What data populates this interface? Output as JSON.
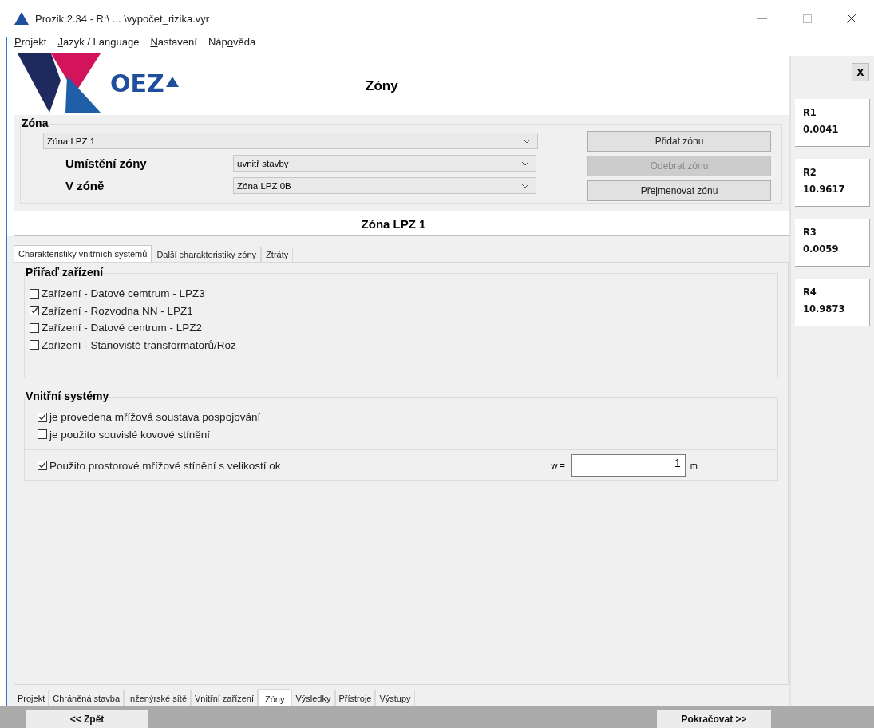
{
  "window": {
    "title": "Prozik 2.34 - R:\\ ... \\vypočet_rizika.vyr"
  },
  "menu": [
    {
      "key": "P",
      "post": "rojekt"
    },
    {
      "key": "J",
      "post": "azyk / Language"
    },
    {
      "key": "N",
      "post": "astavení"
    },
    {
      "pre": "Náp",
      "key": "o",
      "post": "věda"
    }
  ],
  "header": {
    "logo_text": "OEZ",
    "title": "Zóny"
  },
  "zone_group": {
    "legend": "Zóna",
    "zone_select": "Zóna LPZ 1",
    "fields": [
      {
        "label": "Umístění zóny",
        "value": "uvnitř stavby"
      },
      {
        "label": "V zóně",
        "value": "Zóna LPZ 0B"
      }
    ],
    "buttons": [
      {
        "label": "Přidat zónu",
        "disabled": false
      },
      {
        "label": "Odebrat zónu",
        "disabled": true
      },
      {
        "label": "Přejmenovat zónu",
        "disabled": false
      }
    ]
  },
  "zone_title": "Zóna LPZ 1",
  "tabs": [
    {
      "label": "Charakteristiky vnitřních systémů",
      "selected": true
    },
    {
      "label": "Další charakteristiky zóny",
      "selected": false
    },
    {
      "label": "Ztráty",
      "selected": false
    }
  ],
  "devices": {
    "legend": "Přiřaď zařízení",
    "items": [
      {
        "label": "Zařízení - Datové cemtrum - LPZ3",
        "checked": false
      },
      {
        "label": "Zařízení - Rozvodna NN - LPZ1",
        "checked": true
      },
      {
        "label": "Zařízení - Datové centrum - LPZ2",
        "checked": false
      },
      {
        "label": "Zařízení - Stanoviště transformátorů/Roz",
        "checked": false
      }
    ]
  },
  "internal": {
    "legend": "Vnitřní systémy",
    "items": [
      {
        "label": "je provedena mřížová soustava pospojování",
        "checked": true
      },
      {
        "label": "je použito souvislé kovové stínění",
        "checked": false
      }
    ],
    "shield": {
      "label": "Použito prostorové mřížové stínění s velikostí ok",
      "checked": true,
      "w_label": "w =",
      "value": "1",
      "unit": "m"
    }
  },
  "bottom_tabs": [
    {
      "label": "Projekt",
      "selected": false
    },
    {
      "label": "Chráněná stavba",
      "selected": false
    },
    {
      "label": "Inženýrské sítě",
      "selected": false
    },
    {
      "label": "Vnitřní zařízení",
      "selected": false
    },
    {
      "label": "Zóny",
      "selected": true
    },
    {
      "label": "Výsledky",
      "selected": false
    },
    {
      "label": "Přístroje",
      "selected": false
    },
    {
      "label": "Výstupy",
      "selected": false
    }
  ],
  "nav": {
    "back": "<< Zpět",
    "next": "Pokračovat >>"
  },
  "results": {
    "close": "X",
    "cards": [
      {
        "name": "R1",
        "value": "0.0041"
      },
      {
        "name": "R2",
        "value": "10.9617"
      },
      {
        "name": "R3",
        "value": "0.0059"
      },
      {
        "name": "R4",
        "value": "10.9873"
      }
    ]
  }
}
